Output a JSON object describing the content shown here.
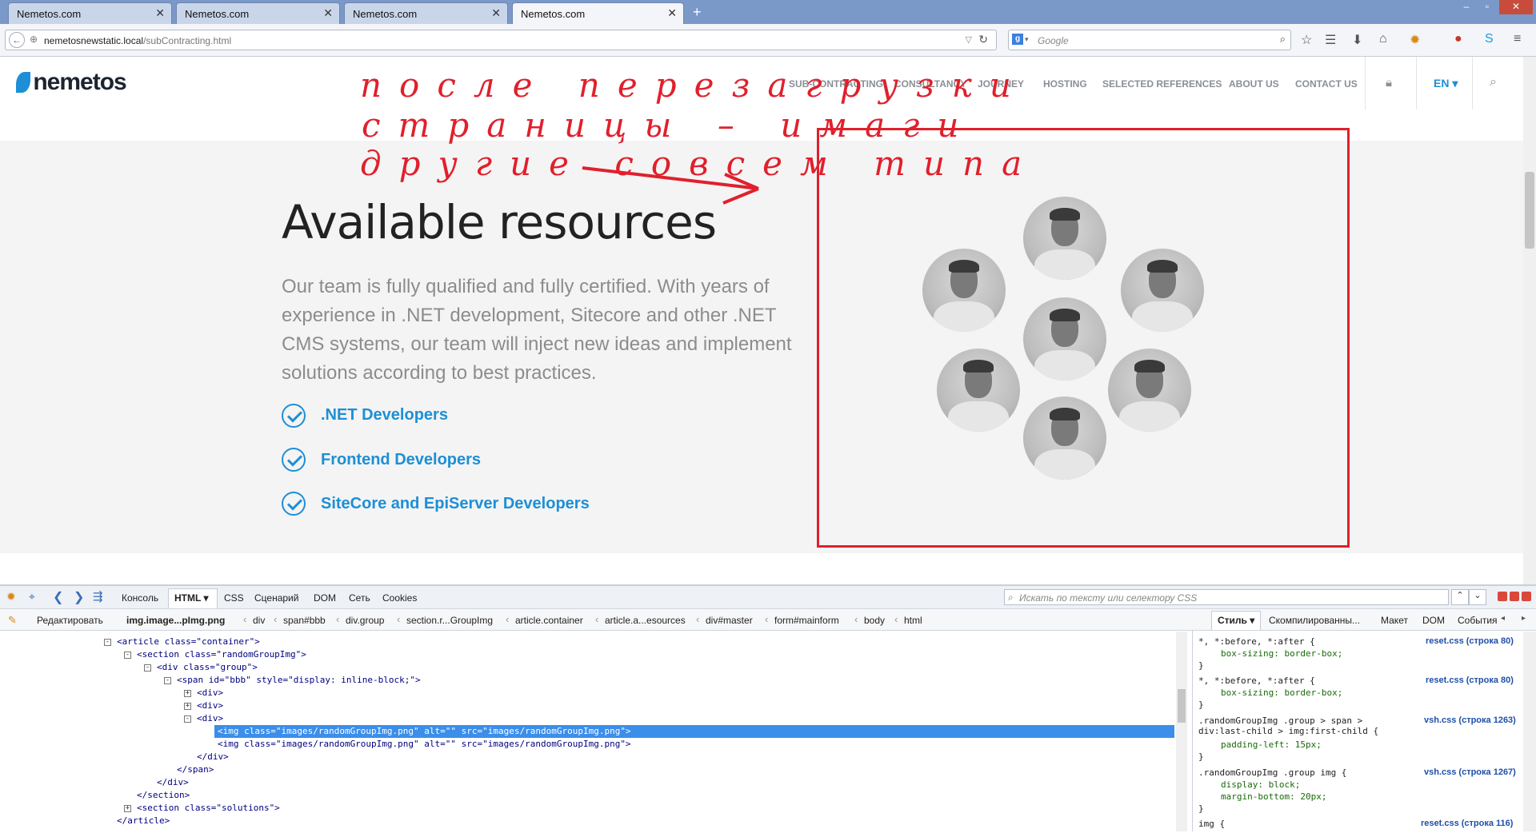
{
  "browser": {
    "tabs": [
      {
        "title": "Nemetos.com",
        "active": false
      },
      {
        "title": "Nemetos.com",
        "active": false
      },
      {
        "title": "Nemetos.com",
        "active": false
      },
      {
        "title": "Nemetos.com",
        "active": true
      }
    ],
    "url_host": "nemetosnewstatic.local",
    "url_path": "/subContracting.html",
    "search_placeholder": "Google",
    "window_controls": {
      "minimize": "–",
      "maximize": "▫",
      "close": "✕"
    }
  },
  "site": {
    "logo": "nemetos",
    "menu": [
      "SUB-CONTRACTING",
      "CONSULTANCY",
      "JOURNEY",
      "HOSTING",
      "SELECTED REFERENCES",
      "ABOUT US",
      "CONTACT US"
    ],
    "language": "EN ▾"
  },
  "section": {
    "heading": "Available resources",
    "description": "Our team is fully qualified and fully certified. With years of experience in .NET development, Sitecore and other .NET CMS systems, our team will inject new ideas and implement solutions according to best practices.",
    "abilities": [
      ".NET Developers",
      "Frontend Developers",
      "SiteCore and EpiServer Developers"
    ]
  },
  "annotation": {
    "lines": [
      "после перезагрузки",
      "страницы – имаги",
      "другие совсем типа"
    ],
    "color": "#e0202c"
  },
  "devtools": {
    "toolbar_tabs": [
      "Консоль",
      "HTML ▾",
      "CSS",
      "Сценарий",
      "DOM",
      "Сеть",
      "Cookies"
    ],
    "search_placeholder": "Искать по тексту или селектору CSS",
    "edit_label": "Редактировать",
    "breadcrumbs": [
      "img.image...pImg.png",
      "div",
      "span#bbb",
      "div.group",
      "section.r...GroupImg",
      "article.container",
      "article.a...esources",
      "div#master",
      "form#mainform",
      "body",
      "html"
    ],
    "side_tabs": [
      "Стиль ▾",
      "Скомпилированны...",
      "Макет",
      "DOM",
      "События"
    ],
    "html_lines": [
      {
        "text": "<article class=\"container\">"
      },
      {
        "text": "<section class=\"randomGroupImg\">"
      },
      {
        "text": "<div class=\"group\">"
      },
      {
        "text": "<span id=\"bbb\" style=\"display: inline-block;\">"
      },
      {
        "text": "<div>"
      },
      {
        "text": "<div>"
      },
      {
        "text": "<div>"
      },
      {
        "text": "<img class=\"images/randomGroupImg.png\" alt=\"\" src=\"images/randomGroupImg.png\">"
      },
      {
        "text": "<img class=\"images/randomGroupImg.png\" alt=\"\" src=\"images/randomGroupImg.png\">"
      },
      {
        "text": "</div>"
      },
      {
        "text": "</span>"
      },
      {
        "text": "</div>"
      },
      {
        "text": "</section>"
      },
      {
        "text": "<section class=\"solutions\">"
      },
      {
        "text": "</article>"
      }
    ],
    "css_rules": [
      {
        "selector": "*, *:before, *:after {",
        "decls": [
          "box-sizing: border-box;"
        ],
        "source": "reset.css (строка 80)"
      },
      {
        "selector": "*, *:before, *:after {",
        "decls": [
          "box-sizing: border-box;"
        ],
        "source": "reset.css (строка 80)"
      },
      {
        "selector": ".randomGroupImg .group > span >\ndiv:last-child > img:first-child {",
        "decls": [
          "padding-left: 15px;"
        ],
        "source": "vsh.css (строка 1263)"
      },
      {
        "selector": ".randomGroupImg .group img {",
        "decls": [
          "display: block;",
          "margin-bottom: 20px;"
        ],
        "source": "vsh.css (строка 1267)"
      },
      {
        "selector": "img {",
        "decls": [],
        "source": "reset.css (строка 116)"
      }
    ]
  }
}
